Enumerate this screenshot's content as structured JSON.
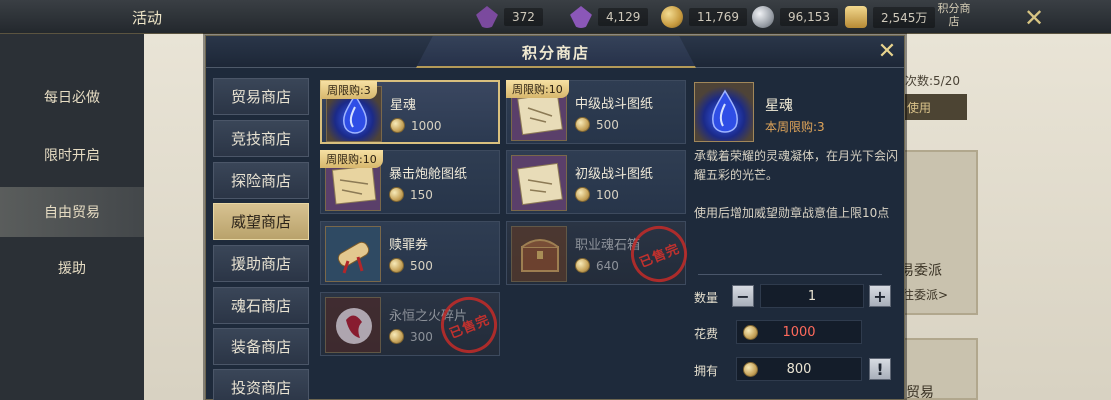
{
  "background": {
    "title": "活动",
    "logo": "",
    "currencies": [
      {
        "icon": "purple-gem-icon",
        "value": "372",
        "color": "#7b4a9e"
      },
      {
        "icon": "purple-crystal-icon",
        "value": "4,129",
        "color": "#8b57b8"
      },
      {
        "icon": "gold-coin-icon",
        "value": "11,769",
        "color": "#c79a3f"
      },
      {
        "icon": "silver-coin-icon",
        "value": "96,153",
        "color": "#9aa0a8"
      },
      {
        "icon": "gold-ingot-icon",
        "value": "2,545万",
        "color": "#d0a24a"
      }
    ],
    "more_label": "积分商店",
    "sidebar": [
      {
        "label": "每日必做",
        "active": false
      },
      {
        "label": "限时开启",
        "active": false
      },
      {
        "label": "自由贸易",
        "active": true
      },
      {
        "label": "援助",
        "active": false
      }
    ],
    "right_count": "次数:5/20",
    "right_use": "使用",
    "commission_title": "易委派",
    "commission_link": "往委派>",
    "trade_title": "贸易"
  },
  "modal": {
    "title": "积分商店",
    "tabs": [
      {
        "label": "贸易商店",
        "active": false
      },
      {
        "label": "竞技商店",
        "active": false
      },
      {
        "label": "探险商店",
        "active": false
      },
      {
        "label": "威望商店",
        "active": true
      },
      {
        "label": "援助商店",
        "active": false
      },
      {
        "label": "魂石商店",
        "active": false
      },
      {
        "label": "装备商店",
        "active": false
      },
      {
        "label": "投资商店",
        "active": false
      }
    ],
    "items": [
      {
        "name": "星魂",
        "price": "1000",
        "limit": "周限购:3",
        "icon": "soul-crystal-icon",
        "selected": true,
        "soldout": false
      },
      {
        "name": "中级战斗图纸",
        "price": "500",
        "limit": "周限购:10",
        "icon": "blueprint-scroll-icon",
        "selected": false,
        "soldout": false
      },
      {
        "name": "暴击炮舱图纸",
        "price": "150",
        "limit": "周限购:10",
        "icon": "blueprint-scroll-icon",
        "selected": false,
        "soldout": false
      },
      {
        "name": "初级战斗图纸",
        "price": "100",
        "limit": "",
        "icon": "blueprint-scroll-icon",
        "selected": false,
        "soldout": false
      },
      {
        "name": "赎罪券",
        "price": "500",
        "limit": "",
        "icon": "red-scroll-icon",
        "selected": false,
        "soldout": false
      },
      {
        "name": "职业魂石箱",
        "price": "640",
        "limit": "",
        "icon": "treasure-chest-icon",
        "selected": false,
        "soldout": true,
        "stamp": "已售完"
      },
      {
        "name": "永恒之火碎片",
        "price": "300",
        "limit": "",
        "icon": "fire-shard-icon",
        "selected": false,
        "soldout": true,
        "stamp": "已售完"
      }
    ],
    "detail": {
      "name": "星魂",
      "weekly_limit": "本周限购:3",
      "description": "承载着荣耀的灵魂凝体，在月光下会闪耀五彩的光芒。",
      "effect": "使用后增加威望勋章战意值上限10点",
      "quantity_label": "数量",
      "quantity": "1",
      "cost_label": "花费",
      "cost": "1000",
      "own_label": "拥有",
      "own": "800",
      "minus": "−",
      "plus": "+",
      "info": "!"
    }
  }
}
